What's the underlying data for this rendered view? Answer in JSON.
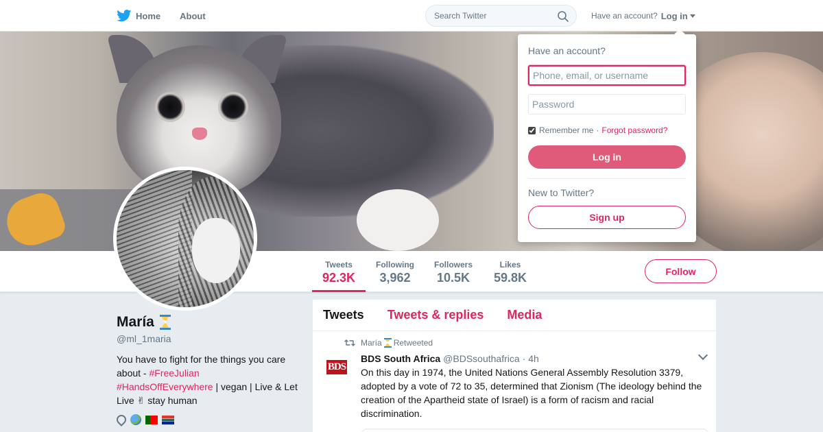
{
  "nav": {
    "home_label": "Home",
    "about_label": "About",
    "search_placeholder": "Search Twitter",
    "account_prompt": "Have an account?",
    "login_label": "Log in"
  },
  "profile": {
    "name": "María",
    "handle": "@ml_1maria",
    "bio_prefix": "You have to fight for the things you care about - ",
    "bio_tag1": "#FreeJulian",
    "bio_tag2": "#HandsOffEverywhere",
    "bio_suffix": " | vegan | Live & Let Live ✌ stay human"
  },
  "stats": [
    {
      "label": "Tweets",
      "value": "92.3K"
    },
    {
      "label": "Following",
      "value": "3,962"
    },
    {
      "label": "Followers",
      "value": "10.5K"
    },
    {
      "label": "Likes",
      "value": "59.8K"
    }
  ],
  "follow_label": "Follow",
  "timeline": {
    "tabs": [
      "Tweets",
      "Tweets & replies",
      "Media"
    ],
    "active_tab": "Tweets",
    "tweet": {
      "retweet_by": "María",
      "retweet_suffix": "Retweeted",
      "avatar_text": "BDS",
      "fullname": "BDS South Africa",
      "screen_name": "@BDSsouthafrica",
      "time": "· 4h",
      "text": "On this day in 1974, the United Nations General Assembly Resolution 3379, adopted by a vote of 72 to 35, determined that Zionism (The ideology behind the creation of the Apartheid state of Israel) is a form of racism and racial discrimination."
    }
  },
  "login_dropdown": {
    "title": "Have an account?",
    "username_placeholder": "Phone, email, or username",
    "password_placeholder": "Password",
    "remember_label": "Remember me",
    "separator": "·",
    "forgot_label": "Forgot password?",
    "login_button": "Log in",
    "new_prompt": "New to Twitter?",
    "signup_button": "Sign up"
  },
  "colors": {
    "accent": "#e0245e",
    "twitter_blue": "#1da1f2",
    "background": "#e6ecf0"
  }
}
